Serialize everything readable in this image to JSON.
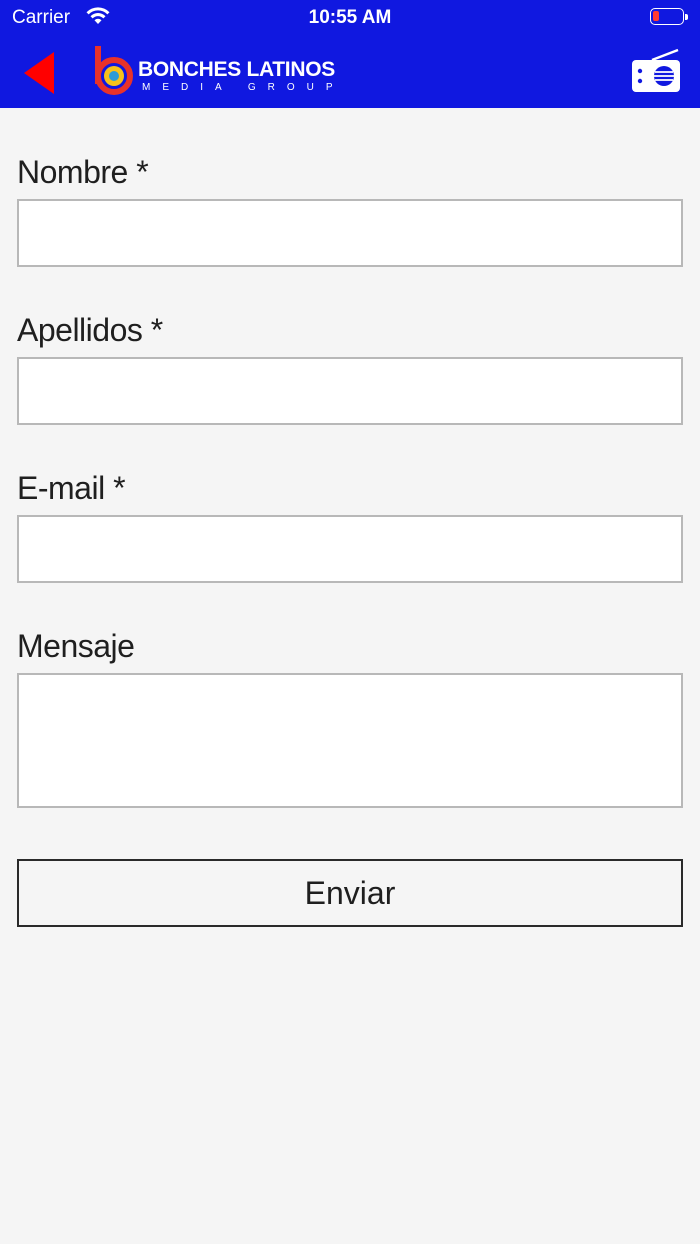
{
  "status_bar": {
    "carrier": "Carrier",
    "time": "10:55 AM"
  },
  "header": {
    "brand_title": "BONCHES LATINOS",
    "brand_subtitle": "MEDIA GROUP",
    "back_icon": "back-arrow-icon",
    "radio_icon": "radio-icon",
    "colors": {
      "bar": "#1018e0",
      "back_arrow": "#ff0000"
    }
  },
  "form": {
    "nombre_label": "Nombre *",
    "apellidos_label": "Apellidos *",
    "email_label": "E-mail *",
    "mensaje_label": "Mensaje",
    "nombre_value": "",
    "apellidos_value": "",
    "email_value": "",
    "mensaje_value": "",
    "submit_label": "Enviar"
  }
}
